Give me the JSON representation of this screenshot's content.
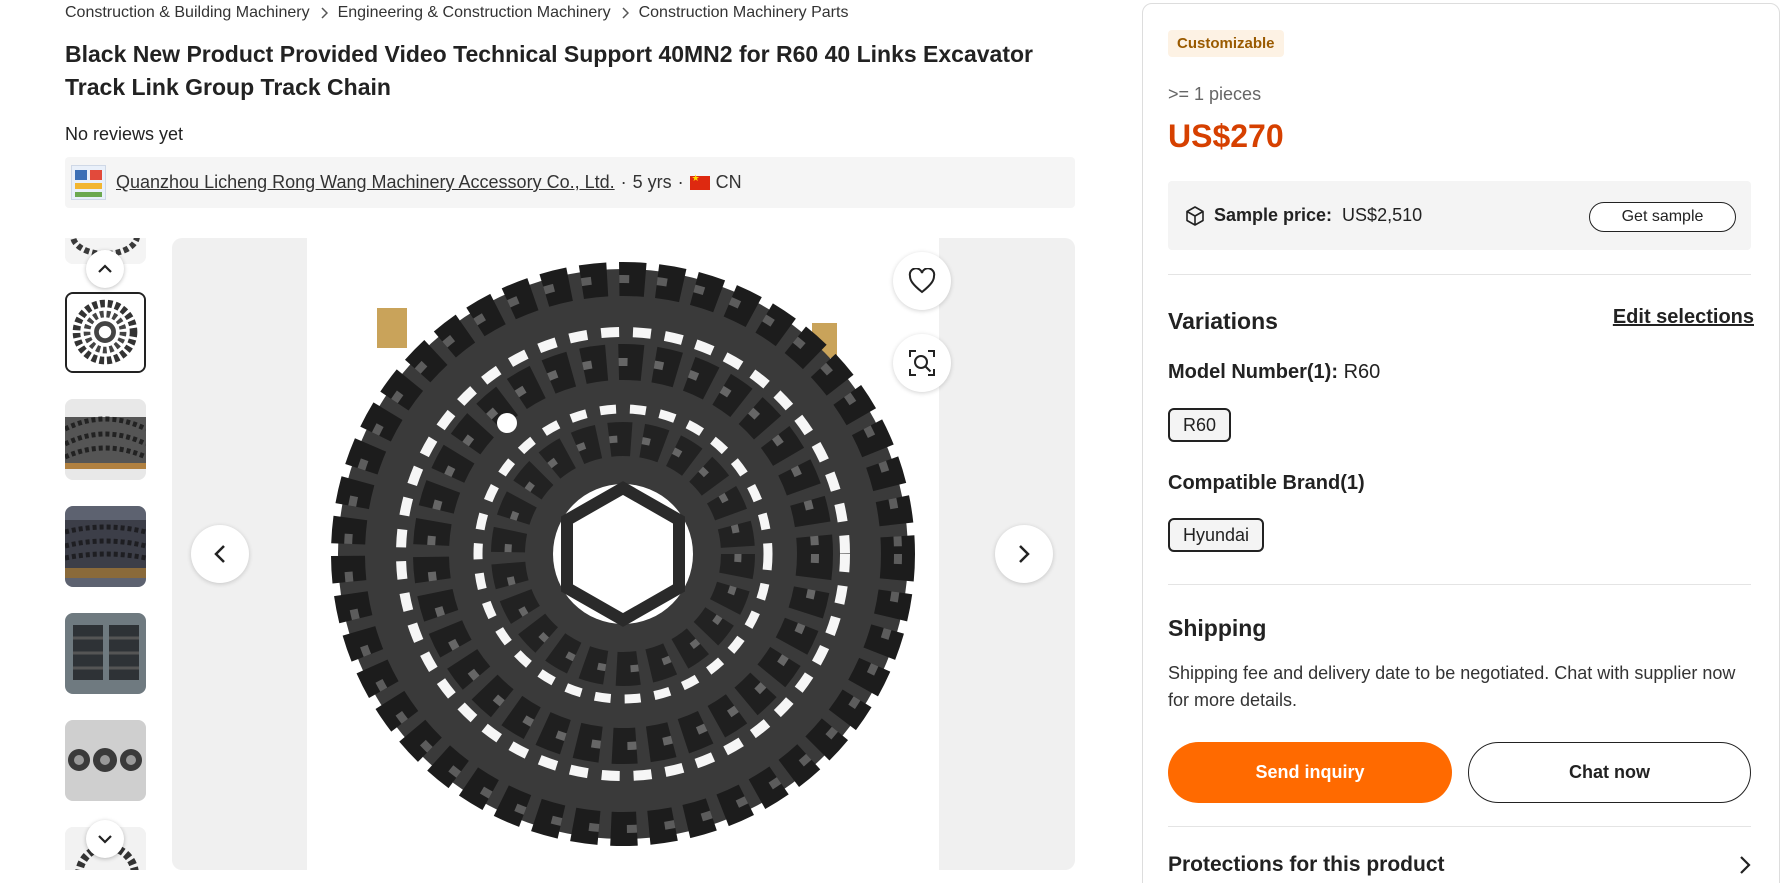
{
  "breadcrumb": {
    "items": [
      "Construction & Building Machinery",
      "Engineering & Construction Machinery",
      "Construction Machinery Parts"
    ]
  },
  "product": {
    "title": "Black New Product Provided Video Technical Support 40MN2 for R60 40 Links Excavator Track Link Group Track Chain",
    "reviews": "No reviews yet"
  },
  "supplier": {
    "name": "Quanzhou Licheng Rong Wang Machinery Accessory Co., Ltd.",
    "years": "5 yrs",
    "country": "CN",
    "separator": "·"
  },
  "gallery": {
    "thumb_count": 7,
    "active_index": 1,
    "icons": {
      "favorite": "heart-icon",
      "visual_search": "image-search-icon",
      "prev": "chevron-left-icon",
      "next": "chevron-right-icon",
      "thumbs_up": "chevron-up-icon",
      "thumbs_down": "chevron-down-icon"
    }
  },
  "purchase": {
    "badge": "Customizable",
    "moq": ">= 1 pieces",
    "price": "US$270",
    "sample_label": "Sample price:",
    "sample_price": "US$2,510",
    "get_sample": "Get sample"
  },
  "variations": {
    "title": "Variations",
    "edit": "Edit selections",
    "model_label": "Model Number(1):",
    "model_value": "R60",
    "model_chip": "R60",
    "brand_label": "Compatible Brand(1)",
    "brand_chip": "Hyundai"
  },
  "shipping": {
    "title": "Shipping",
    "text": "Shipping fee and delivery date to be negotiated. Chat with supplier now for more details."
  },
  "actions": {
    "inquiry": "Send inquiry",
    "chat": "Chat now"
  },
  "protections": {
    "title": "Protections for this product"
  },
  "colors": {
    "accent": "#ff6a00",
    "price": "#d64000",
    "badge_bg": "#fdf2e4",
    "badge_text": "#9a5a00"
  }
}
